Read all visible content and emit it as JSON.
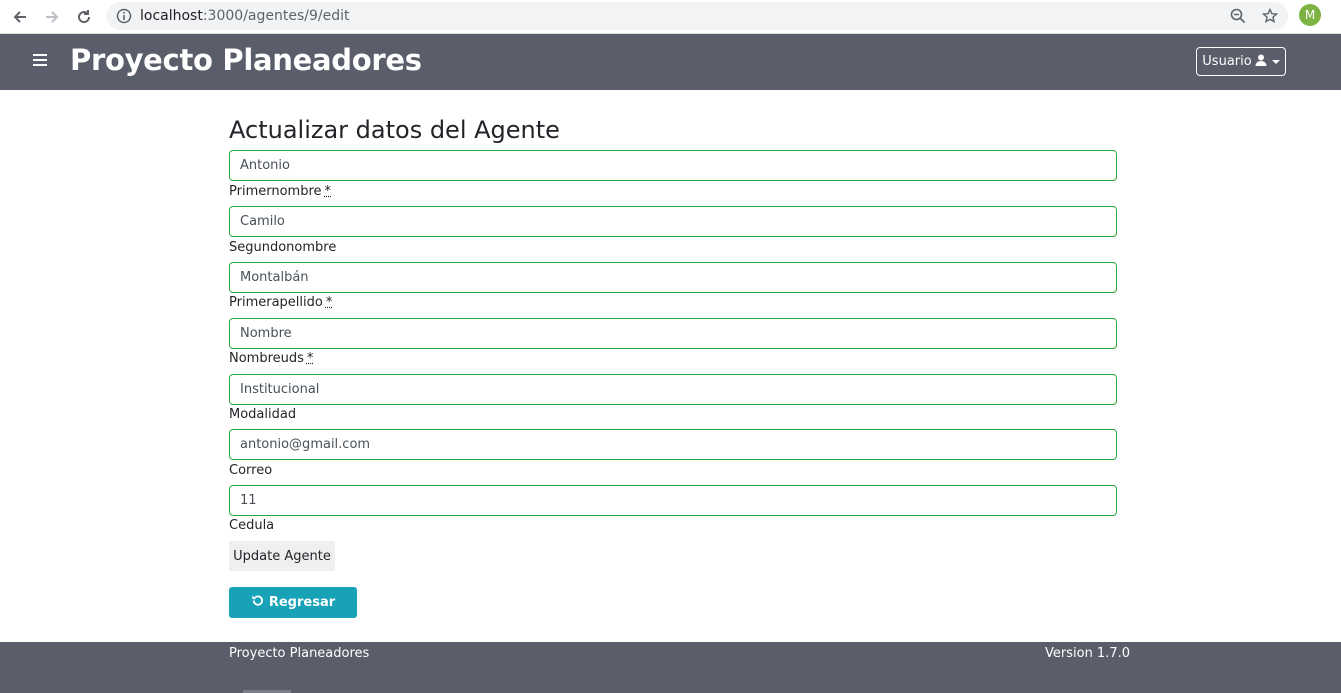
{
  "browser": {
    "url_host": "localhost",
    "url_path": ":3000/agentes/9/edit",
    "profile_initial": "M"
  },
  "navbar": {
    "brand": "Proyecto Planeadores",
    "user_button": "Usuario"
  },
  "form": {
    "title": "Actualizar datos del Agente",
    "fields": [
      {
        "value": "Antonio",
        "label": "Primernombre",
        "required_mark": "*"
      },
      {
        "value": "Camilo",
        "label": "Segundonombre",
        "required_mark": ""
      },
      {
        "value": "Montalbán",
        "label": "Primerapellido",
        "required_mark": "*"
      },
      {
        "value": "Nombre",
        "label": "Nombreuds",
        "required_mark": "*"
      },
      {
        "value": "Institucional",
        "label": "Modalidad",
        "required_mark": ""
      },
      {
        "value": "antonio@gmail.com",
        "label": "Correo",
        "required_mark": ""
      },
      {
        "value": "11",
        "label": "Cedula",
        "required_mark": ""
      }
    ],
    "submit_label": "Update Agente",
    "back_label": "Regresar"
  },
  "footer": {
    "left": "Proyecto Planeadores",
    "right": "Version 1.7.0"
  },
  "colors": {
    "navbar": "#5a5d6a",
    "field_border": "#28a745",
    "back_button": "#17a2b8"
  },
  "icons": [
    "back-arrow-icon",
    "forward-arrow-icon",
    "reload-icon",
    "info-icon",
    "zoom-icon",
    "star-icon",
    "hamburger-icon",
    "user-icon",
    "caret-down-icon",
    "undo-icon"
  ]
}
